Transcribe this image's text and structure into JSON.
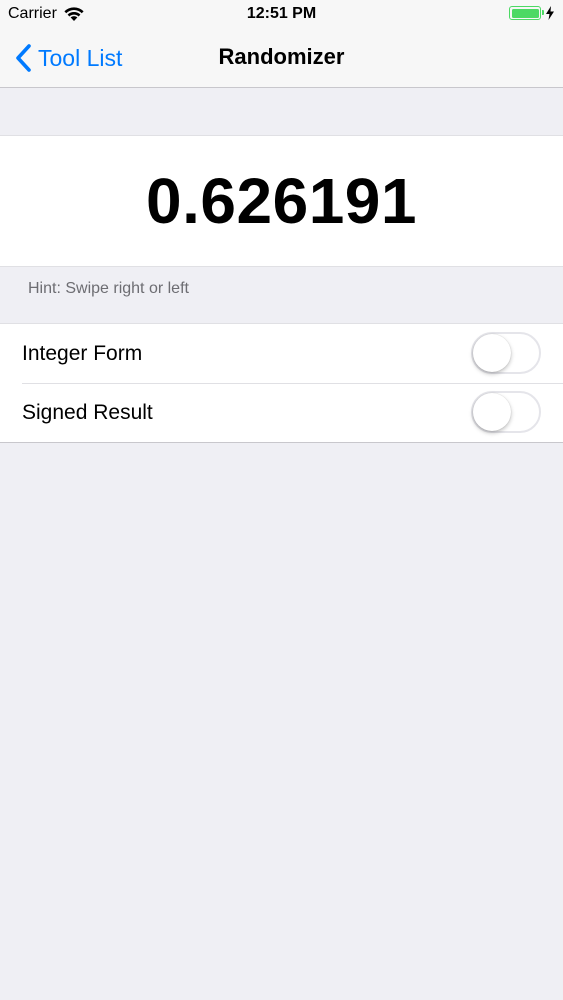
{
  "status_bar": {
    "carrier": "Carrier",
    "time": "12:51 PM",
    "battery_level": 1.0,
    "charging": true,
    "battery_color": "#4cd964"
  },
  "nav": {
    "back_label": "Tool List",
    "title": "Randomizer",
    "tint_color": "#007aff"
  },
  "result": {
    "value": "0.626191"
  },
  "hint": "Hint: Swipe right or left",
  "settings": [
    {
      "label": "Integer Form",
      "enabled": false
    },
    {
      "label": "Signed Result",
      "enabled": false
    }
  ],
  "icons": {
    "wifi": "wifi-icon",
    "back": "chevron-left-icon",
    "charging": "bolt-icon"
  }
}
